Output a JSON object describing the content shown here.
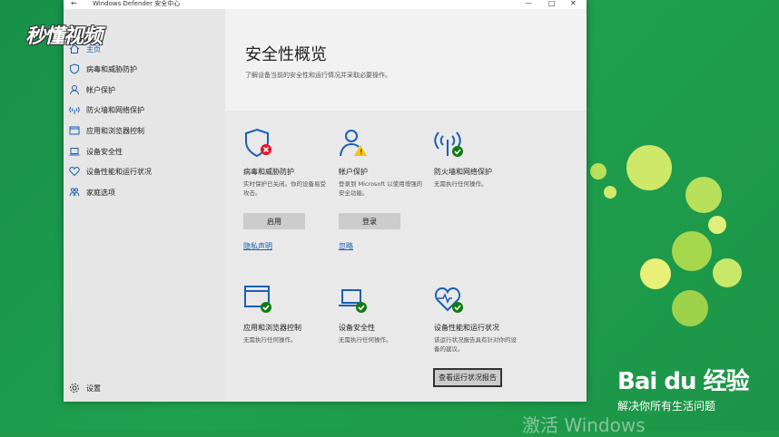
{
  "window": {
    "title": "Windows Defender 安全中心",
    "back_glyph": "←",
    "minimize_glyph": "—",
    "maximize_glyph": "□",
    "close_glyph": "✕"
  },
  "sidebar": {
    "items": [
      {
        "label": "主页",
        "icon": "home-icon"
      },
      {
        "label": "病毒和威胁防护",
        "icon": "shield-icon"
      },
      {
        "label": "帐户保护",
        "icon": "person-icon"
      },
      {
        "label": "防火墙和网络保护",
        "icon": "wifi-icon"
      },
      {
        "label": "应用和浏览器控制",
        "icon": "browser-icon"
      },
      {
        "label": "设备安全性",
        "icon": "laptop-icon"
      },
      {
        "label": "设备性能和运行状况",
        "icon": "heart-icon"
      },
      {
        "label": "家庭选项",
        "icon": "family-icon"
      }
    ],
    "settings_label": "设置"
  },
  "main": {
    "title": "安全性概览",
    "subtitle": "了解设备当前的安全性和运行情况并采取必要操作。",
    "cards": [
      {
        "title": "病毒和威胁防护",
        "desc": "实时保护已关闭。你的设备易受攻击。",
        "button": "启用",
        "link": "隐私声明",
        "status": "error"
      },
      {
        "title": "帐户保护",
        "desc": "登录到 Microsoft 以使用增强的安全功能。",
        "button": "登录",
        "link": "忽略",
        "status": "warning"
      },
      {
        "title": "防火墙和网络保护",
        "desc": "无需执行任何操作。",
        "status": "ok"
      },
      {
        "title": "应用和浏览器控制",
        "desc": "无需执行任何操作。",
        "status": "ok"
      },
      {
        "title": "设备安全性",
        "desc": "无需执行任何操作。",
        "status": "warning"
      },
      {
        "title": "设备性能和运行状况",
        "desc": "该运行状况报告具有针对你的设备的建议。",
        "button": "查看运行状况报告",
        "status": "ok"
      }
    ]
  },
  "overlay": {
    "watermark": "秒懂视频",
    "baidu_brand": "Bai du 经验",
    "baidu_slogan": "解决你所有生活问题",
    "activate_text": "激活 Windows"
  },
  "colors": {
    "accent": "#1a5fb4",
    "error": "#e81123",
    "warning": "#f5c400",
    "ok": "#107c10",
    "desktop": "#1f9a4a"
  }
}
